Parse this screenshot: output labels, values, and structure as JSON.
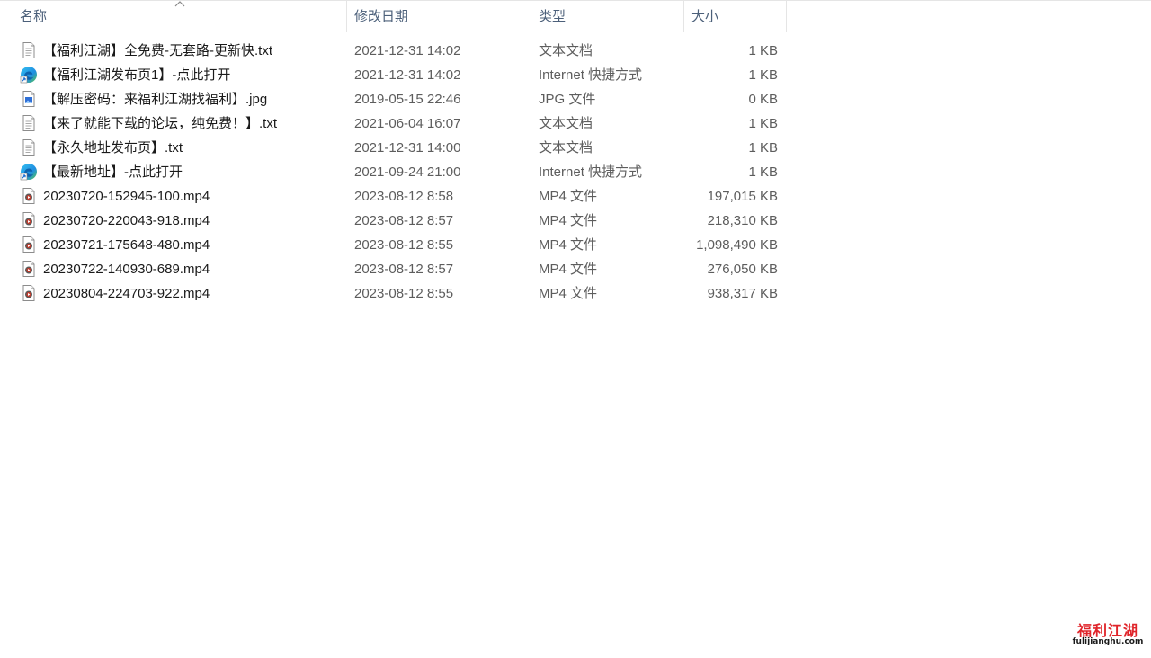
{
  "columns": {
    "name": "名称",
    "date": "修改日期",
    "type": "类型",
    "size": "大小",
    "sort_icon": "chevron-up-icon"
  },
  "files": [
    {
      "name": "【福利江湖】全免费-无套路-更新快.txt",
      "date": "2021-12-31 14:02",
      "type": "文本文档",
      "size": "1 KB",
      "icon": "text-file-icon"
    },
    {
      "name": "【福利江湖发布页1】-点此打开",
      "date": "2021-12-31 14:02",
      "type": "Internet 快捷方式",
      "size": "1 KB",
      "icon": "edge-shortcut-icon"
    },
    {
      "name": "【解压密码：来福利江湖找福利】.jpg",
      "date": "2019-05-15 22:46",
      "type": "JPG 文件",
      "size": "0 KB",
      "icon": "image-file-icon"
    },
    {
      "name": "【来了就能下载的论坛，纯免费！】.txt",
      "date": "2021-06-04 16:07",
      "type": "文本文档",
      "size": "1 KB",
      "icon": "text-file-icon"
    },
    {
      "name": "【永久地址发布页】.txt",
      "date": "2021-12-31 14:00",
      "type": "文本文档",
      "size": "1 KB",
      "icon": "text-file-icon"
    },
    {
      "name": "【最新地址】-点此打开",
      "date": "2021-09-24 21:00",
      "type": "Internet 快捷方式",
      "size": "1 KB",
      "icon": "edge-shortcut-icon"
    },
    {
      "name": "20230720-152945-100.mp4",
      "date": "2023-08-12 8:58",
      "type": "MP4 文件",
      "size": "197,015 KB",
      "icon": "video-file-icon"
    },
    {
      "name": "20230720-220043-918.mp4",
      "date": "2023-08-12 8:57",
      "type": "MP4 文件",
      "size": "218,310 KB",
      "icon": "video-file-icon"
    },
    {
      "name": "20230721-175648-480.mp4",
      "date": "2023-08-12 8:55",
      "type": "MP4 文件",
      "size": "1,098,490 KB",
      "icon": "video-file-icon"
    },
    {
      "name": "20230722-140930-689.mp4",
      "date": "2023-08-12 8:57",
      "type": "MP4 文件",
      "size": "276,050 KB",
      "icon": "video-file-icon"
    },
    {
      "name": "20230804-224703-922.mp4",
      "date": "2023-08-12 8:55",
      "type": "MP4 文件",
      "size": "938,317 KB",
      "icon": "video-file-icon"
    }
  ],
  "watermark": {
    "title": "福利江湖",
    "url": "fulijianghu.com"
  },
  "colors": {
    "header_text": "#4c607a",
    "detail_text": "#5d5d5d",
    "watermark_red": "#e0242a"
  }
}
